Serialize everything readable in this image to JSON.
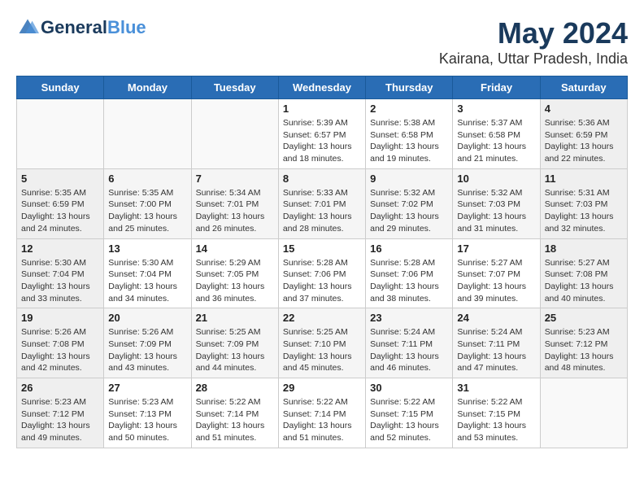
{
  "header": {
    "logo_line1": "General",
    "logo_line2": "Blue",
    "title": "May 2024",
    "subtitle": "Kairana, Uttar Pradesh, India"
  },
  "weekdays": [
    "Sunday",
    "Monday",
    "Tuesday",
    "Wednesday",
    "Thursday",
    "Friday",
    "Saturday"
  ],
  "weeks": [
    [
      {
        "day": "",
        "info": ""
      },
      {
        "day": "",
        "info": ""
      },
      {
        "day": "",
        "info": ""
      },
      {
        "day": "1",
        "info": "Sunrise: 5:39 AM\nSunset: 6:57 PM\nDaylight: 13 hours\nand 18 minutes."
      },
      {
        "day": "2",
        "info": "Sunrise: 5:38 AM\nSunset: 6:58 PM\nDaylight: 13 hours\nand 19 minutes."
      },
      {
        "day": "3",
        "info": "Sunrise: 5:37 AM\nSunset: 6:58 PM\nDaylight: 13 hours\nand 21 minutes."
      },
      {
        "day": "4",
        "info": "Sunrise: 5:36 AM\nSunset: 6:59 PM\nDaylight: 13 hours\nand 22 minutes."
      }
    ],
    [
      {
        "day": "5",
        "info": "Sunrise: 5:35 AM\nSunset: 6:59 PM\nDaylight: 13 hours\nand 24 minutes."
      },
      {
        "day": "6",
        "info": "Sunrise: 5:35 AM\nSunset: 7:00 PM\nDaylight: 13 hours\nand 25 minutes."
      },
      {
        "day": "7",
        "info": "Sunrise: 5:34 AM\nSunset: 7:01 PM\nDaylight: 13 hours\nand 26 minutes."
      },
      {
        "day": "8",
        "info": "Sunrise: 5:33 AM\nSunset: 7:01 PM\nDaylight: 13 hours\nand 28 minutes."
      },
      {
        "day": "9",
        "info": "Sunrise: 5:32 AM\nSunset: 7:02 PM\nDaylight: 13 hours\nand 29 minutes."
      },
      {
        "day": "10",
        "info": "Sunrise: 5:32 AM\nSunset: 7:03 PM\nDaylight: 13 hours\nand 31 minutes."
      },
      {
        "day": "11",
        "info": "Sunrise: 5:31 AM\nSunset: 7:03 PM\nDaylight: 13 hours\nand 32 minutes."
      }
    ],
    [
      {
        "day": "12",
        "info": "Sunrise: 5:30 AM\nSunset: 7:04 PM\nDaylight: 13 hours\nand 33 minutes."
      },
      {
        "day": "13",
        "info": "Sunrise: 5:30 AM\nSunset: 7:04 PM\nDaylight: 13 hours\nand 34 minutes."
      },
      {
        "day": "14",
        "info": "Sunrise: 5:29 AM\nSunset: 7:05 PM\nDaylight: 13 hours\nand 36 minutes."
      },
      {
        "day": "15",
        "info": "Sunrise: 5:28 AM\nSunset: 7:06 PM\nDaylight: 13 hours\nand 37 minutes."
      },
      {
        "day": "16",
        "info": "Sunrise: 5:28 AM\nSunset: 7:06 PM\nDaylight: 13 hours\nand 38 minutes."
      },
      {
        "day": "17",
        "info": "Sunrise: 5:27 AM\nSunset: 7:07 PM\nDaylight: 13 hours\nand 39 minutes."
      },
      {
        "day": "18",
        "info": "Sunrise: 5:27 AM\nSunset: 7:08 PM\nDaylight: 13 hours\nand 40 minutes."
      }
    ],
    [
      {
        "day": "19",
        "info": "Sunrise: 5:26 AM\nSunset: 7:08 PM\nDaylight: 13 hours\nand 42 minutes."
      },
      {
        "day": "20",
        "info": "Sunrise: 5:26 AM\nSunset: 7:09 PM\nDaylight: 13 hours\nand 43 minutes."
      },
      {
        "day": "21",
        "info": "Sunrise: 5:25 AM\nSunset: 7:09 PM\nDaylight: 13 hours\nand 44 minutes."
      },
      {
        "day": "22",
        "info": "Sunrise: 5:25 AM\nSunset: 7:10 PM\nDaylight: 13 hours\nand 45 minutes."
      },
      {
        "day": "23",
        "info": "Sunrise: 5:24 AM\nSunset: 7:11 PM\nDaylight: 13 hours\nand 46 minutes."
      },
      {
        "day": "24",
        "info": "Sunrise: 5:24 AM\nSunset: 7:11 PM\nDaylight: 13 hours\nand 47 minutes."
      },
      {
        "day": "25",
        "info": "Sunrise: 5:23 AM\nSunset: 7:12 PM\nDaylight: 13 hours\nand 48 minutes."
      }
    ],
    [
      {
        "day": "26",
        "info": "Sunrise: 5:23 AM\nSunset: 7:12 PM\nDaylight: 13 hours\nand 49 minutes."
      },
      {
        "day": "27",
        "info": "Sunrise: 5:23 AM\nSunset: 7:13 PM\nDaylight: 13 hours\nand 50 minutes."
      },
      {
        "day": "28",
        "info": "Sunrise: 5:22 AM\nSunset: 7:14 PM\nDaylight: 13 hours\nand 51 minutes."
      },
      {
        "day": "29",
        "info": "Sunrise: 5:22 AM\nSunset: 7:14 PM\nDaylight: 13 hours\nand 51 minutes."
      },
      {
        "day": "30",
        "info": "Sunrise: 5:22 AM\nSunset: 7:15 PM\nDaylight: 13 hours\nand 52 minutes."
      },
      {
        "day": "31",
        "info": "Sunrise: 5:22 AM\nSunset: 7:15 PM\nDaylight: 13 hours\nand 53 minutes."
      },
      {
        "day": "",
        "info": ""
      }
    ]
  ]
}
